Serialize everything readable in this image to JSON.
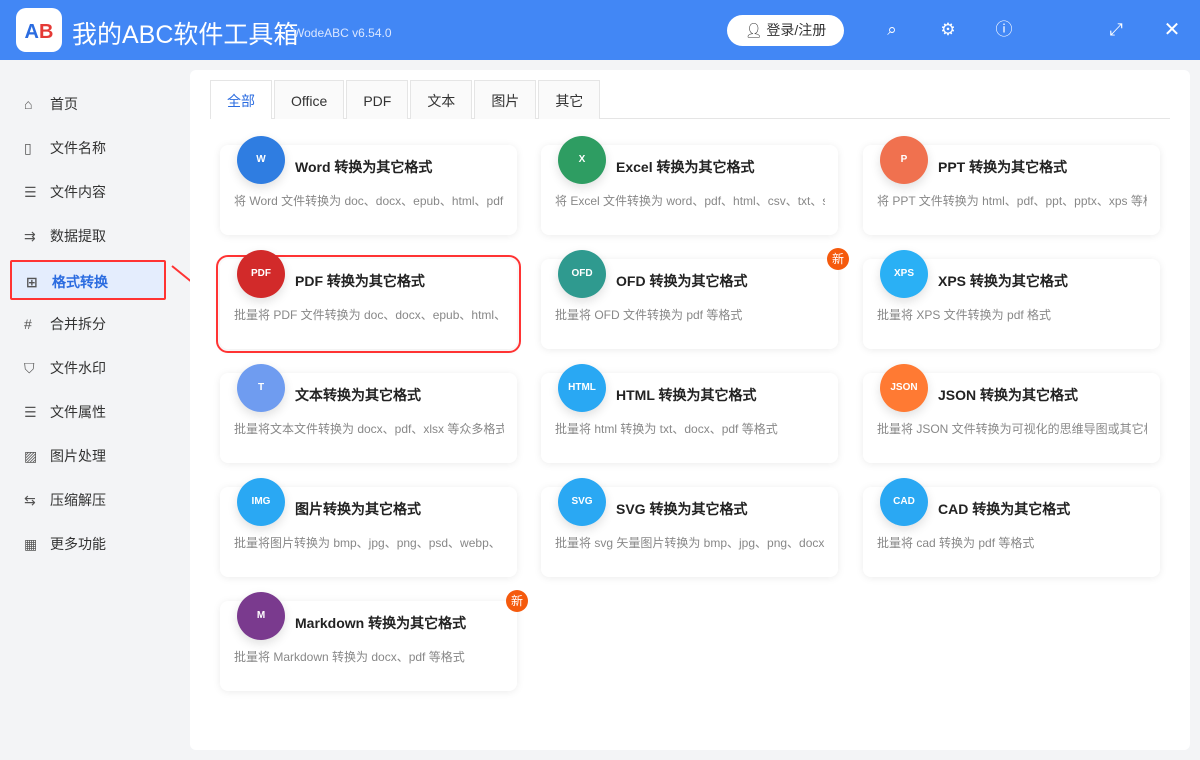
{
  "app": {
    "logo_text": "AB",
    "title": "我的ABC软件工具箱",
    "version": "WodeABC v6.54.0",
    "login": "登录/注册"
  },
  "sidebar": {
    "items": [
      {
        "label": "首页",
        "icon": "⌂"
      },
      {
        "label": "文件名称",
        "icon": "▯"
      },
      {
        "label": "文件内容",
        "icon": "☰"
      },
      {
        "label": "数据提取",
        "icon": "⇉"
      },
      {
        "label": "格式转换",
        "icon": "⊞"
      },
      {
        "label": "合并拆分",
        "icon": "#"
      },
      {
        "label": "文件水印",
        "icon": "⛉"
      },
      {
        "label": "文件属性",
        "icon": "☰"
      },
      {
        "label": "图片处理",
        "icon": "▨"
      },
      {
        "label": "压缩解压",
        "icon": "⇆"
      },
      {
        "label": "更多功能",
        "icon": "▦"
      }
    ]
  },
  "tabs": [
    "全部",
    "Office",
    "PDF",
    "文本",
    "图片",
    "其它"
  ],
  "cards": [
    {
      "title": "Word 转换为其它格式",
      "desc": "将 Word 文件转换为 doc、docx、epub、html、pdf",
      "glyph": "W",
      "color": "#2f7de1"
    },
    {
      "title": "Excel 转换为其它格式",
      "desc": "将 Excel 文件转换为 word、pdf、html、csv、txt、svg",
      "glyph": "X",
      "color": "#2e9d62"
    },
    {
      "title": "PPT 转换为其它格式",
      "desc": "将 PPT 文件转换为 html、pdf、ppt、pptx、xps 等格式",
      "glyph": "P",
      "color": "#f0714f"
    },
    {
      "title": "PDF 转换为其它格式",
      "desc": "批量将 PDF 文件转换为 doc、docx、epub、html、",
      "glyph": "PDF",
      "color": "#d22a2a"
    },
    {
      "title": "OFD 转换为其它格式",
      "desc": "批量将 OFD 文件转换为 pdf 等格式",
      "glyph": "OFD",
      "color": "#2f9a8f",
      "badge": "新"
    },
    {
      "title": "XPS 转换为其它格式",
      "desc": "批量将 XPS 文件转换为 pdf 格式",
      "glyph": "XPS",
      "color": "#2ab0f5"
    },
    {
      "title": "文本转换为其它格式",
      "desc": "批量将文本文件转换为 docx、pdf、xlsx 等众多格式",
      "glyph": "T",
      "color": "#6f9cf0"
    },
    {
      "title": "HTML 转换为其它格式",
      "desc": "批量将 html 转换为 txt、docx、pdf 等格式",
      "glyph": "HTML",
      "color": "#29a8f3"
    },
    {
      "title": "JSON 转换为其它格式",
      "desc": "批量将 JSON 文件转换为可视化的思维导图或其它格式",
      "glyph": "JSON",
      "color": "#ff7a33"
    },
    {
      "title": "图片转换为其它格式",
      "desc": "批量将图片转换为 bmp、jpg、png、psd、webp、",
      "glyph": "IMG",
      "color": "#2aa8f3"
    },
    {
      "title": "SVG 转换为其它格式",
      "desc": "批量将 svg 矢量图片转换为 bmp、jpg、png、docx",
      "glyph": "SVG",
      "color": "#2aa8f3"
    },
    {
      "title": "CAD 转换为其它格式",
      "desc": "批量将 cad 转换为 pdf 等格式",
      "glyph": "CAD",
      "color": "#2aa8f3"
    },
    {
      "title": "Markdown 转换为其它格式",
      "desc": "批量将 Markdown 转换为 docx、pdf 等格式",
      "glyph": "M",
      "color": "#7a3a8e",
      "badge": "新"
    }
  ]
}
